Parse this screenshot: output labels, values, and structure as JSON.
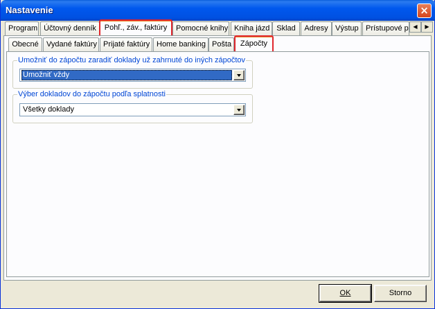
{
  "window": {
    "title": "Nastavenie",
    "close_glyph": "×"
  },
  "main_tabs": [
    {
      "label": "Program"
    },
    {
      "label": "Účtovný denník"
    },
    {
      "label": "Pohľ., záv., faktúry"
    },
    {
      "label": "Pomocné knihy"
    },
    {
      "label": "Kniha jázd"
    },
    {
      "label": "Sklad"
    },
    {
      "label": "Adresy"
    },
    {
      "label": "Výstup"
    },
    {
      "label": "Prístupové pr"
    }
  ],
  "main_tabs_active": "Pohľ., záv., faktúry",
  "tab_scroll": {
    "left_glyph": "◀",
    "right_glyph": "▶"
  },
  "sub_tabs": [
    {
      "label": "Obecné"
    },
    {
      "label": "Vydané faktúry"
    },
    {
      "label": "Prijaté faktúry"
    },
    {
      "label": "Home banking"
    },
    {
      "label": "Pošta"
    },
    {
      "label": "Zápočty"
    }
  ],
  "sub_tabs_active": "Zápočty",
  "group1": {
    "legend": "Umožniť do zápočtu zaradiť doklady už zahrnuté do iných zápočtov",
    "value": "Umožniť vždy"
  },
  "group2": {
    "legend": "Výber dokladov do zápočtu podľa splatnosti",
    "value": "Všetky doklady"
  },
  "buttons": {
    "ok": "OK",
    "cancel": "Storno"
  },
  "colors": {
    "accent_titlebar": "#0058ee",
    "highlight_box": "#e0262d",
    "legend_text": "#0046d5",
    "selection": "#316ac5"
  }
}
